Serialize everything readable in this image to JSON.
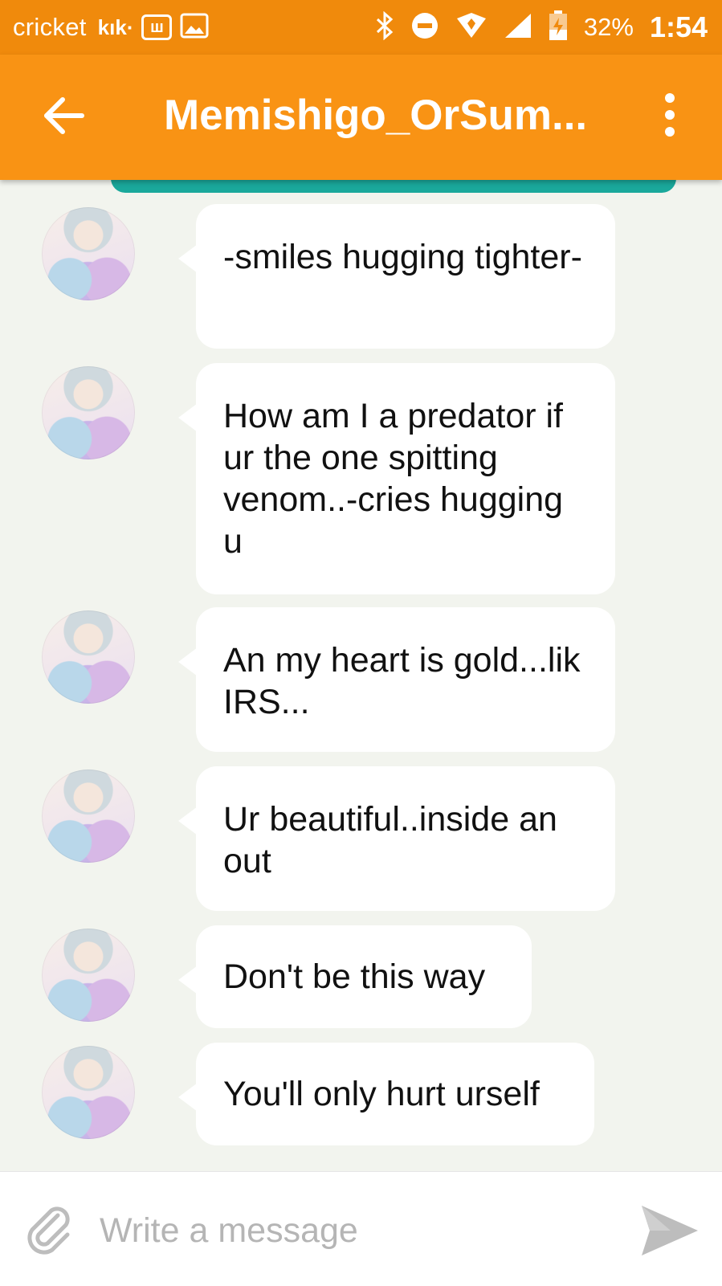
{
  "status_bar": {
    "carrier": "cricket",
    "kik": "kık·",
    "battery_percent": "32%",
    "time": "1:54",
    "icons": [
      "whatsapp-box-icon",
      "image-icon",
      "bluetooth-icon",
      "do-not-disturb-icon",
      "wifi-icon",
      "signal-icon",
      "battery-icon"
    ]
  },
  "app_bar": {
    "title": "Memishigo_OrSum...",
    "back_icon": "arrow-left-icon",
    "menu_icon": "more-vert-icon",
    "color": "#f99314"
  },
  "messages": [
    {
      "text": "-smiles hugging tighter-"
    },
    {
      "text": "How am I a predator if ur the one spitting venom..-cries hugging u"
    },
    {
      "text": "An my heart is gold...lik IRS..."
    },
    {
      "text": "Ur beautiful..inside an out"
    },
    {
      "text": "Don't be this way"
    },
    {
      "text": "You'll only hurt urself"
    }
  ],
  "compose": {
    "placeholder": "Write a message",
    "attach_icon": "paperclip-icon",
    "send_icon": "send-icon"
  },
  "colors": {
    "status_bar": "#f08a0c",
    "accent": "#f99314",
    "teal": "#1aa89b",
    "chat_background": "#f2f4ee"
  }
}
